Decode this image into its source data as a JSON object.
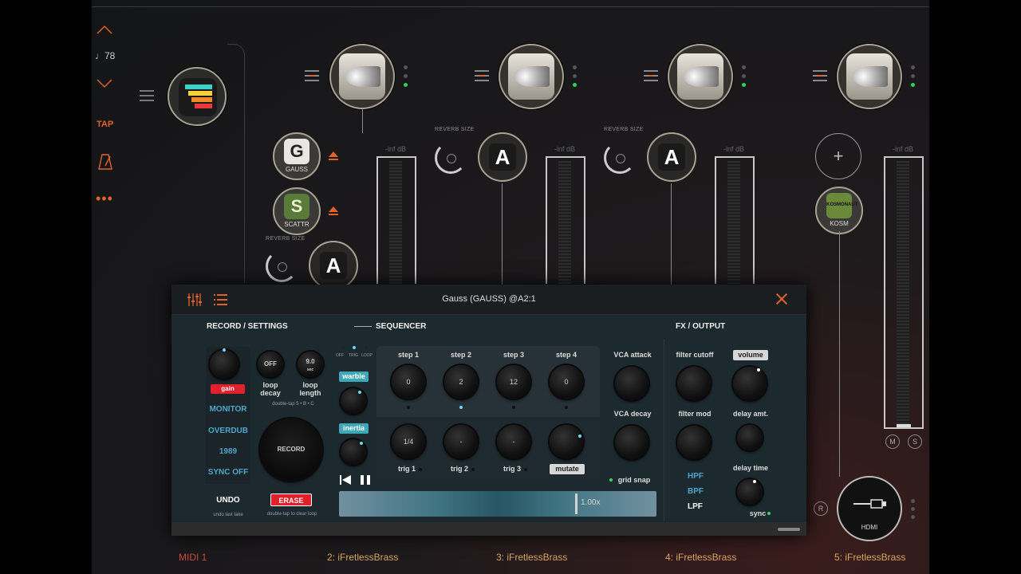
{
  "left_rail": {
    "tempo": "♩78",
    "tap_label": "TAP"
  },
  "tracks": [
    {
      "label": "MIDI 1",
      "color": "#c94a3a"
    },
    {
      "label": "2: iFretlessBrass",
      "meter_label": "-inf dB",
      "plugins": [
        "GAUSS",
        "SCATTR"
      ],
      "reverb_label": "REVERB SIZE"
    },
    {
      "label": "3: iFretlessBrass",
      "meter_label": "-inf dB",
      "reverb_label": "REVERB SIZE"
    },
    {
      "label": "4: iFretlessBrass",
      "meter_label": "-inf dB",
      "reverb_label": "REVERB SIZE"
    },
    {
      "label": "5: iFretlessBrass",
      "meter_label": "-inf dB",
      "plugin": "KOSM",
      "kosm_text": "KOSMONAUT",
      "m_label": "M",
      "s_label": "S",
      "r_label": "R",
      "output": "HDMI"
    }
  ],
  "gauss_icon": "G",
  "scattr_icon": "S",
  "a_icon": "A",
  "plus": "+",
  "dialog": {
    "title": "Gauss (GAUSS) @A2:1",
    "sections": {
      "record": "RECORD / SETTINGS",
      "sequencer": "SEQUENCER",
      "fx": "FX / OUTPUT"
    },
    "record": {
      "gain_label": "gain",
      "loop_decay_value": "OFF",
      "loop_decay_label": "loop\ndecay",
      "loop_length_value": "9.0",
      "loop_length_unit": "sec",
      "loop_length_label": "loop\nlength",
      "loop_hint": "double-tap 5 • B • C",
      "modes": [
        "MONITOR",
        "OVERDUB",
        "1989",
        "SYNC OFF"
      ],
      "record_button": "RECORD",
      "undo": "UNDO",
      "undo_hint": "undo last take",
      "erase": "ERASE",
      "erase_hint": "double-tap to clear loop"
    },
    "sequencer": {
      "mode_labels": [
        "OFF",
        "TRIG",
        "LOOP"
      ],
      "warble": "warble",
      "inertia": "inertia",
      "steps": [
        {
          "label": "step 1",
          "value": "0"
        },
        {
          "label": "step 2",
          "value": "2"
        },
        {
          "label": "step 3",
          "value": "12"
        },
        {
          "label": "step 4",
          "value": "0"
        }
      ],
      "trigs": [
        {
          "label": "trig 1",
          "value": "1/4"
        },
        {
          "label": "trig 2",
          "value": "-"
        },
        {
          "label": "trig 3",
          "value": "-"
        },
        {
          "label": "mutate",
          "value": ""
        }
      ],
      "grid_snap": "grid snap",
      "speed": "1.00x"
    },
    "fx": {
      "vca_attack": "VCA attack",
      "vca_decay": "VCA decay",
      "filter_cutoff": "filter cutoff",
      "filter_mod": "filter mod",
      "volume": "volume",
      "delay_amt": "delay amt.",
      "delay_time": "delay time",
      "sync": "sync",
      "filters": [
        "HPF",
        "BPF",
        "LPF"
      ]
    }
  }
}
